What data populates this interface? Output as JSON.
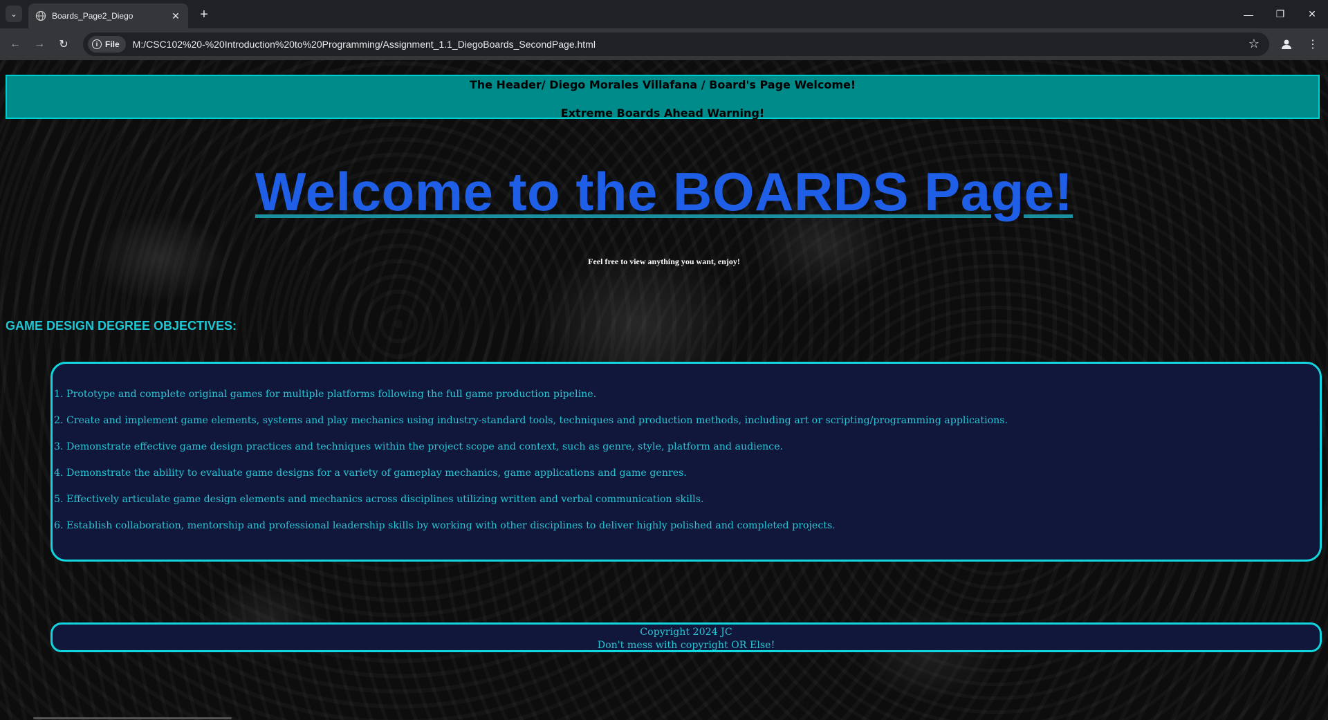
{
  "browser": {
    "tab_title": "Boards_Page2_Diego",
    "chip_label": "File",
    "url": "M:/CSC102%20-%20Introduction%20to%20Programming/Assignment_1.1_DiegoBoards_SecondPage.html"
  },
  "header": {
    "line1": "The Header/ Diego Morales Villafana / Board's Page Welcome!",
    "line2": "Extreme Boards Ahead Warning!"
  },
  "main": {
    "title": "Welcome to the BOARDS Page!",
    "subtitle": "Feel free to view anything you want, enjoy!",
    "objectives_heading": "GAME DESIGN DEGREE OBJECTIVES:",
    "objectives": [
      "1. Prototype and complete original games for multiple platforms following the full game production pipeline.",
      "2. Create and implement game elements, systems and play mechanics using industry-standard tools, techniques and production methods, including art or scripting/programming applications.",
      "3. Demonstrate effective game design practices and techniques within the project scope and context, such as genre, style, platform and audience.",
      "4. Demonstrate the ability to evaluate game designs for a variety of gameplay mechanics, game applications and game genres.",
      "5. Effectively articulate game design elements and mechanics across disciplines utilizing written and verbal communication skills.",
      "6. Establish collaboration, mentorship and professional leadership skills by working with other disciplines to deliver highly polished and completed projects."
    ]
  },
  "footer": {
    "line1": "Copyright 2024 JC",
    "line2": "Don't mess with copyright OR Else!"
  },
  "colors": {
    "header_bg": "#008b8b",
    "accent_cyan": "#12d6df",
    "title_blue": "#1f5ee6",
    "box_bg": "#10173a"
  }
}
